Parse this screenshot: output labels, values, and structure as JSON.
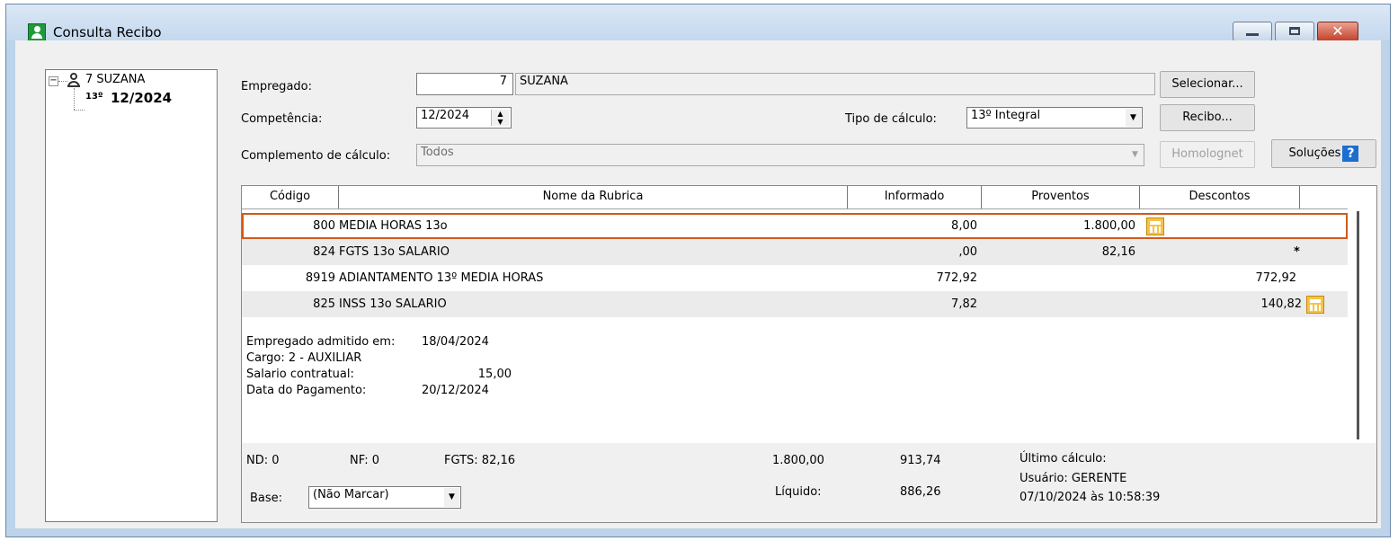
{
  "window": {
    "title": "Consulta Recibo"
  },
  "tree": {
    "toggle": "−",
    "employee": "7 SUZANA",
    "period_prefix": "13º",
    "period": "12/2024"
  },
  "form": {
    "empregado_label": "Empregado:",
    "empregado_code": "7",
    "empregado_name": "SUZANA",
    "competencia_label": "Competência:",
    "competencia_value": "12/2024",
    "tipo_label": "Tipo de cálculo:",
    "tipo_value": "13º Integral",
    "complemento_label": "Complemento de cálculo:",
    "complemento_value": "Todos"
  },
  "buttons": {
    "selecionar": "Selecionar...",
    "recibo": "Recibo...",
    "homolognet": "Homolognet",
    "solucoes": "Soluções",
    "help": "?"
  },
  "grid": {
    "headers": [
      "Código",
      "Nome da Rubrica",
      "Informado",
      "Proventos",
      "Descontos"
    ],
    "rows": [
      {
        "code": "800",
        "name": "MEDIA HORAS 13o",
        "informado": "8,00",
        "proventos": "1.800,00",
        "descontos": "",
        "mark": ""
      },
      {
        "code": "824",
        "name": "FGTS 13o SALARIO",
        "informado": ",00",
        "proventos": "82,16",
        "descontos": "",
        "mark": "*"
      },
      {
        "code": "8919",
        "name": "ADIANTAMENTO 13º MEDIA HORAS",
        "informado": "772,92",
        "proventos": "",
        "descontos": "772,92",
        "mark": ""
      },
      {
        "code": "825",
        "name": "INSS 13o SALARIO",
        "informado": "7,82",
        "proventos": "",
        "descontos": "140,82",
        "mark": ""
      }
    ]
  },
  "info": {
    "admitido_label": "Empregado admitido em:",
    "admitido_value": "18/04/2024",
    "cargo": "Cargo: 2 - AUXILIAR",
    "salario_label": "Salario contratual:",
    "salario_value": "15,00",
    "pagamento_label": "Data do Pagamento:",
    "pagamento_value": "20/12/2024"
  },
  "footer": {
    "nd": "ND:  0",
    "nf": "NF:  0",
    "fgts": "FGTS:  82,16",
    "total_proventos": "1.800,00",
    "total_descontos": "913,74",
    "liquido_label": "Líquido:",
    "liquido_value": "886,26",
    "ultimo_label": "Último cálculo:",
    "usuario": "Usuário: GERENTE",
    "data_calculo": "07/10/2024 às 10:58:39",
    "base_label": "Base:",
    "base_value": "(Não Marcar)"
  },
  "colors": {
    "selected_row_border": "#d05a1c",
    "calc_icon": "#f6c346"
  }
}
